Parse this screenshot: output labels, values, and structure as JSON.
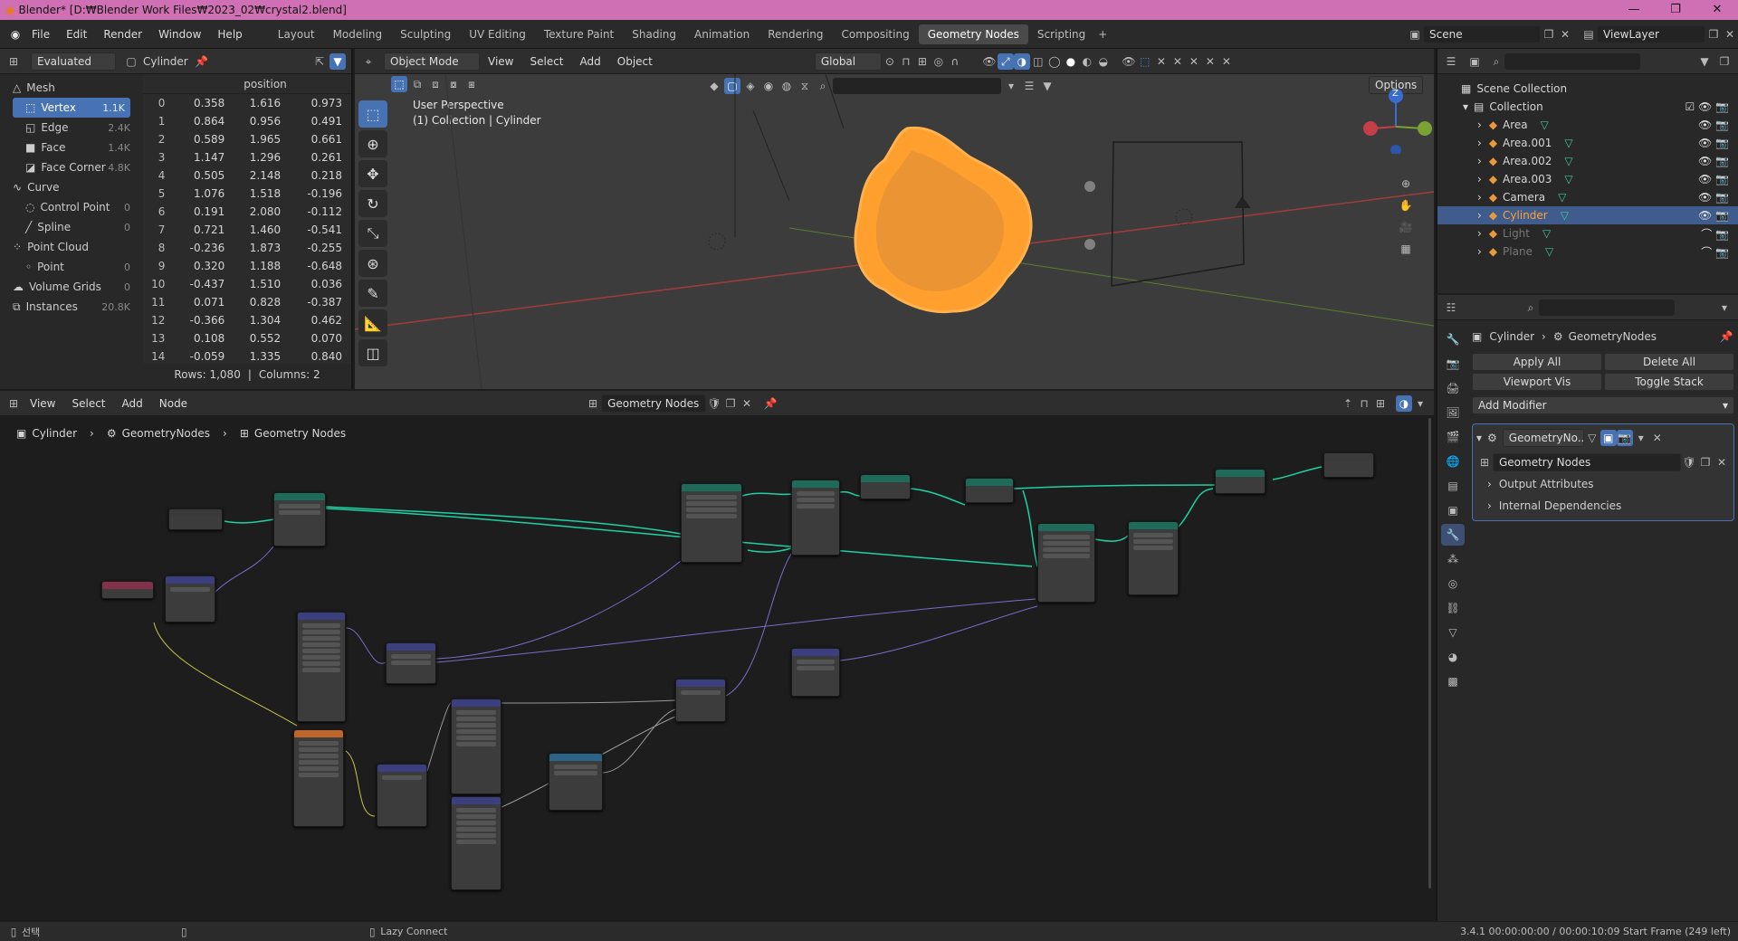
{
  "window": {
    "title": "Blender* [D:₩Blender Work Files₩2023_02₩crystal2.blend]",
    "minimize": "—",
    "maximize": "❐",
    "close": "✕"
  },
  "menu": [
    "File",
    "Edit",
    "Render",
    "Window",
    "Help"
  ],
  "workspaces": [
    "Layout",
    "Modeling",
    "Sculpting",
    "UV Editing",
    "Texture Paint",
    "Shading",
    "Animation",
    "Rendering",
    "Compositing",
    "Geometry Nodes",
    "Scripting"
  ],
  "active_workspace": "Geometry Nodes",
  "scene": {
    "name": "Scene",
    "view_layer": "ViewLayer"
  },
  "spreadsheet": {
    "mode": "Evaluated",
    "object": "Cylinder",
    "domains": [
      {
        "label": "Mesh",
        "count": ""
      },
      {
        "label": "Vertex",
        "count": "1.1K"
      },
      {
        "label": "Edge",
        "count": "2.4K"
      },
      {
        "label": "Face",
        "count": "1.4K"
      },
      {
        "label": "Face Corner",
        "count": "4.8K"
      },
      {
        "label": "Curve",
        "count": ""
      },
      {
        "label": "Control Point",
        "count": "0"
      },
      {
        "label": "Spline",
        "count": "0"
      },
      {
        "label": "Point Cloud",
        "count": ""
      },
      {
        "label": "Point",
        "count": "0"
      },
      {
        "label": "Volume Grids",
        "count": "0"
      },
      {
        "label": "Instances",
        "count": "20.8K"
      }
    ],
    "column_header": "position",
    "rows": [
      [
        "0",
        "0.358",
        "1.616",
        "0.973"
      ],
      [
        "1",
        "0.864",
        "0.956",
        "0.491"
      ],
      [
        "2",
        "0.589",
        "1.965",
        "0.661"
      ],
      [
        "3",
        "1.147",
        "1.296",
        "0.261"
      ],
      [
        "4",
        "0.505",
        "2.148",
        "0.218"
      ],
      [
        "5",
        "1.076",
        "1.518",
        "-0.196"
      ],
      [
        "6",
        "0.191",
        "2.080",
        "-0.112"
      ],
      [
        "7",
        "0.721",
        "1.460",
        "-0.541"
      ],
      [
        "8",
        "-0.236",
        "1.873",
        "-0.255"
      ],
      [
        "9",
        "0.320",
        "1.188",
        "-0.648"
      ],
      [
        "10",
        "-0.437",
        "1.510",
        "0.036"
      ],
      [
        "11",
        "0.071",
        "0.828",
        "-0.387"
      ],
      [
        "12",
        "-0.366",
        "1.304",
        "0.462"
      ],
      [
        "13",
        "0.108",
        "0.552",
        "0.070"
      ],
      [
        "14",
        "-0.059",
        "1.335",
        "0.840"
      ]
    ],
    "footer_rows": "Rows: 1,080",
    "footer_cols": "Columns: 2"
  },
  "viewport": {
    "mode": "Object Mode",
    "menus": [
      "View",
      "Select",
      "Add",
      "Object"
    ],
    "orientation": "Global",
    "options": "Options",
    "perspective": "User Perspective",
    "context": "(1) Collection | Cylinder",
    "gizmo_z": "Z"
  },
  "outliner": {
    "root": "Scene Collection",
    "collection": "Collection",
    "items": [
      {
        "name": "Area",
        "selected": false,
        "hidden": false
      },
      {
        "name": "Area.001",
        "selected": false,
        "hidden": false
      },
      {
        "name": "Area.002",
        "selected": false,
        "hidden": false
      },
      {
        "name": "Area.003",
        "selected": false,
        "hidden": false
      },
      {
        "name": "Camera",
        "selected": false,
        "hidden": false
      },
      {
        "name": "Cylinder",
        "selected": true,
        "hidden": false
      },
      {
        "name": "Light",
        "selected": false,
        "hidden": true
      },
      {
        "name": "Plane",
        "selected": false,
        "hidden": true
      }
    ]
  },
  "properties": {
    "object": "Cylinder",
    "modifier_path": "GeometryNodes",
    "apply_all": "Apply All",
    "delete_all": "Delete All",
    "viewport_vis": "Viewport Vis",
    "toggle_stack": "Toggle Stack",
    "add_modifier": "Add Modifier",
    "modifier_name": "GeometryNo...",
    "node_group": "Geometry Nodes",
    "output_attributes": "Output Attributes",
    "internal_dependencies": "Internal Dependencies"
  },
  "node_editor": {
    "menus": [
      "View",
      "Select",
      "Add",
      "Node"
    ],
    "node_group": "Geometry Nodes",
    "breadcrumb": [
      "Cylinder",
      "GeometryNodes",
      "Geometry Nodes"
    ]
  },
  "status": {
    "left": "선택",
    "middle": "Lazy Connect",
    "right": "3.4.1  00:00:00:00 / 00:00:10:09  Start Frame (249 left)"
  },
  "colors": {
    "accent": "#4772b3",
    "title_bar": "#cf6fb4",
    "selection_orange": "#ffa033",
    "link_green": "#1fd1a0"
  }
}
